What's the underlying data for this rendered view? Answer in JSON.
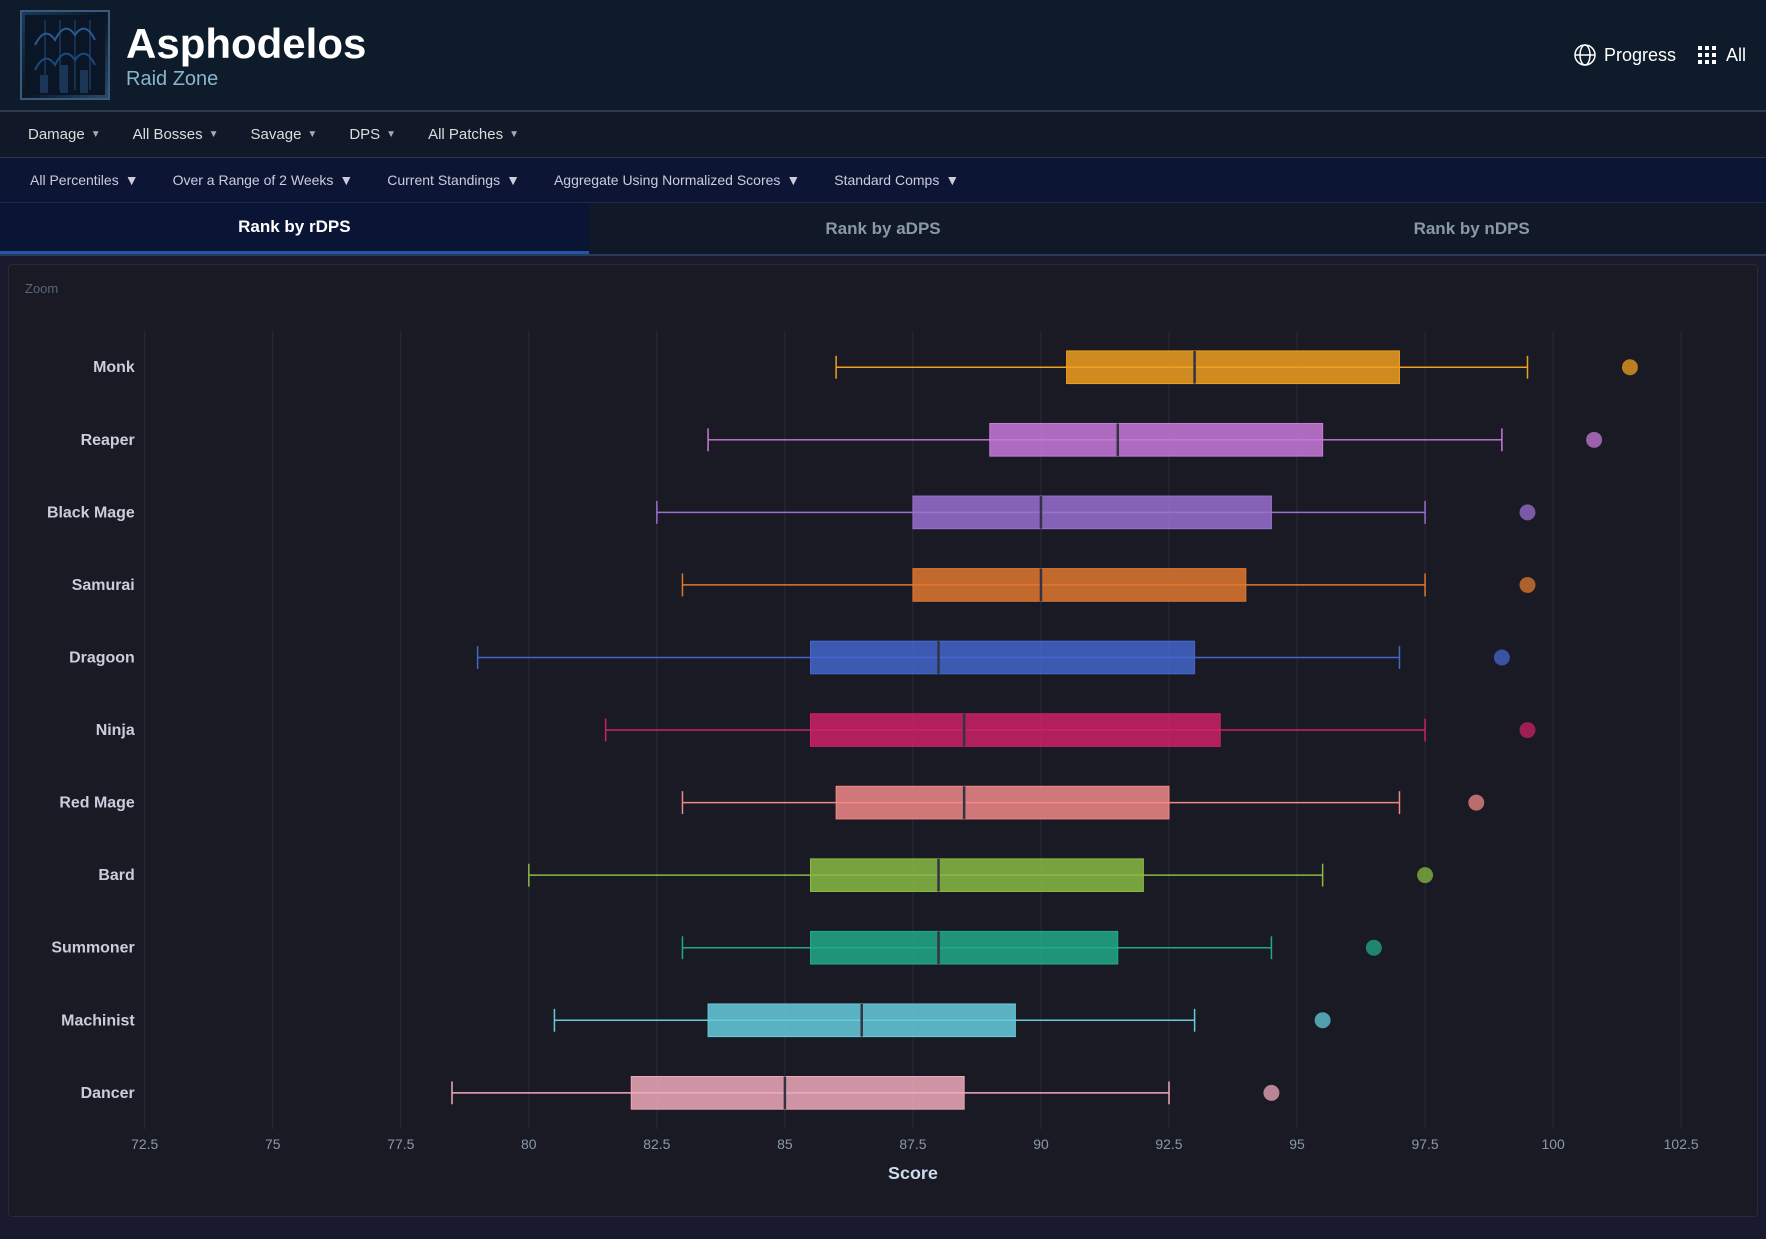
{
  "header": {
    "title": "Asphodelos",
    "subtitle": "Raid Zone",
    "progress_label": "Progress",
    "all_label": "All"
  },
  "toolbar": {
    "filters": [
      "Damage",
      "All Bosses",
      "Savage",
      "DPS",
      "All Patches"
    ]
  },
  "filterbar": {
    "filters": [
      "All Percentiles",
      "Over a Range of 2 Weeks",
      "Current Standings",
      "Aggregate Using Normalized Scores",
      "Standard Comps"
    ]
  },
  "tabs": [
    "Rank by rDPS",
    "Rank by aDPS",
    "Rank by nDPS"
  ],
  "active_tab": 0,
  "chart": {
    "zoom_label": "Zoom",
    "x_label": "Score",
    "x_min": 72.5,
    "x_max": 102.5,
    "x_ticks": [
      72.5,
      75,
      77.5,
      80,
      82.5,
      85,
      87.5,
      90,
      92.5,
      95,
      97.5,
      100,
      102.5
    ],
    "jobs": [
      {
        "name": "Monk",
        "color": "#f0a020",
        "whisker_low": 86.0,
        "q1": 90.5,
        "median": 93.0,
        "q3": 97.0,
        "whisker_high": 99.5,
        "outlier": 101.5
      },
      {
        "name": "Reaper",
        "color": "#c87adb",
        "whisker_low": 83.5,
        "q1": 89.0,
        "median": 91.5,
        "q3": 95.5,
        "whisker_high": 99.0,
        "outlier": 100.8
      },
      {
        "name": "Black Mage",
        "color": "#9a70d0",
        "whisker_low": 82.5,
        "q1": 87.5,
        "median": 90.0,
        "q3": 94.5,
        "whisker_high": 97.5,
        "outlier": 99.5
      },
      {
        "name": "Samurai",
        "color": "#e07830",
        "whisker_low": 83.0,
        "q1": 87.5,
        "median": 90.0,
        "q3": 94.0,
        "whisker_high": 97.5,
        "outlier": 99.5
      },
      {
        "name": "Dragoon",
        "color": "#4466cc",
        "whisker_low": 79.0,
        "q1": 85.5,
        "median": 88.0,
        "q3": 93.0,
        "whisker_high": 97.0,
        "outlier": 99.0
      },
      {
        "name": "Ninja",
        "color": "#cc2266",
        "whisker_low": 81.5,
        "q1": 85.5,
        "median": 88.5,
        "q3": 93.5,
        "whisker_high": 97.5,
        "outlier": 99.5
      },
      {
        "name": "Red Mage",
        "color": "#f08888",
        "whisker_low": 83.0,
        "q1": 86.0,
        "median": 88.5,
        "q3": 92.5,
        "whisker_high": 97.0,
        "outlier": 98.5
      },
      {
        "name": "Bard",
        "color": "#88bb44",
        "whisker_low": 80.0,
        "q1": 85.5,
        "median": 88.0,
        "q3": 92.0,
        "whisker_high": 95.5,
        "outlier": 97.5
      },
      {
        "name": "Summoner",
        "color": "#22aa88",
        "whisker_low": 83.0,
        "q1": 85.5,
        "median": 88.0,
        "q3": 91.5,
        "whisker_high": 94.5,
        "outlier": 96.5
      },
      {
        "name": "Machinist",
        "color": "#66ccdd",
        "whisker_low": 80.5,
        "q1": 83.5,
        "median": 86.5,
        "q3": 89.5,
        "whisker_high": 93.0,
        "outlier": 95.5
      },
      {
        "name": "Dancer",
        "color": "#f0aabb",
        "whisker_low": 78.5,
        "q1": 82.0,
        "median": 85.0,
        "q3": 88.5,
        "whisker_high": 92.5,
        "outlier": 94.5
      }
    ]
  }
}
